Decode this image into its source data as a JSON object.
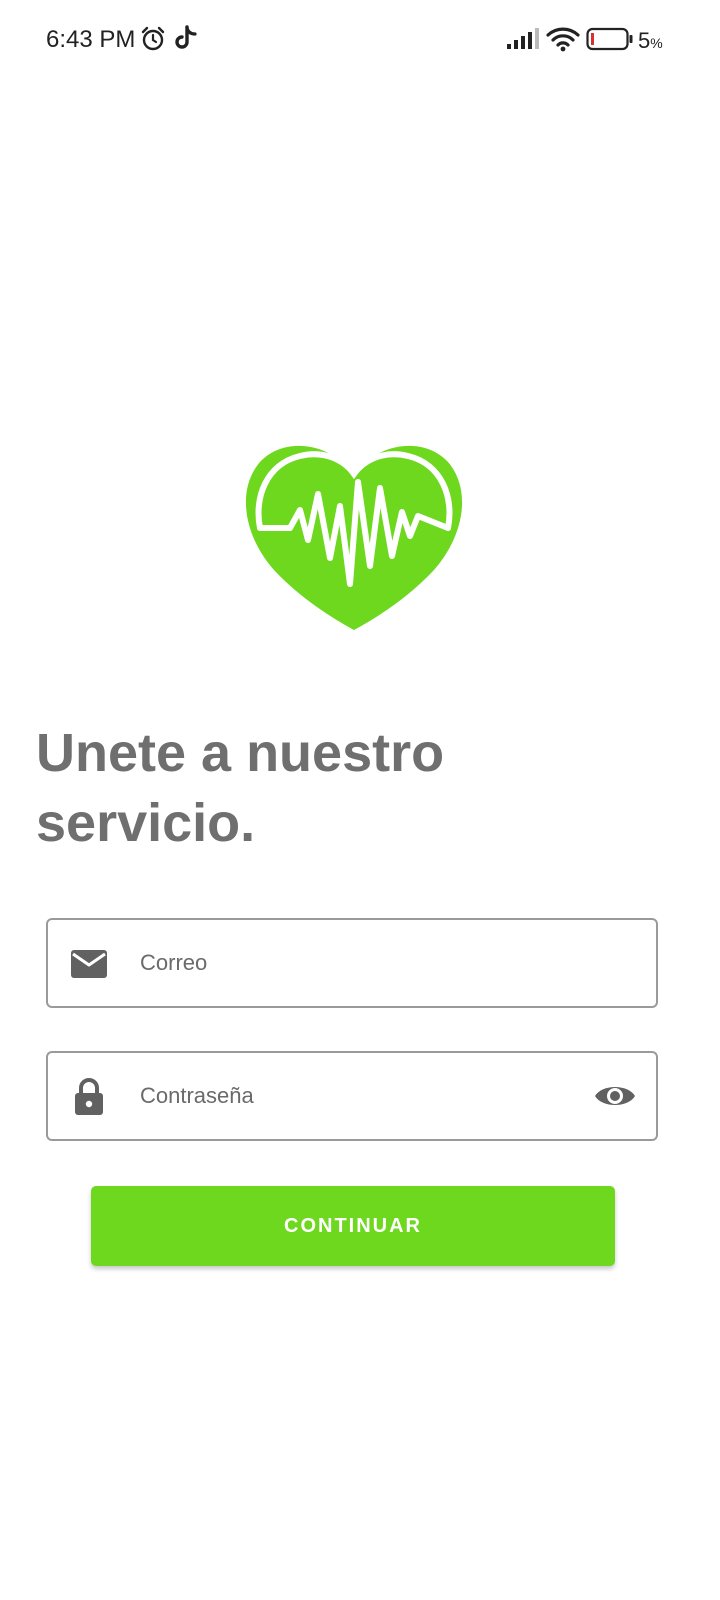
{
  "status_bar": {
    "time": "6:43 PM",
    "battery_percent": "5",
    "battery_unit": "%",
    "icons": [
      "alarm-icon",
      "tiktok-icon",
      "signal-icon",
      "wifi-icon",
      "battery-icon"
    ]
  },
  "logo": {
    "icon": "heart-pulse-icon",
    "color": "#6ed81f"
  },
  "headline": {
    "text": "Unete a nuestro servicio."
  },
  "form": {
    "email": {
      "icon": "mail-icon",
      "placeholder": "Correo",
      "value": ""
    },
    "password": {
      "icon": "lock-icon",
      "placeholder": "Contraseña",
      "value": "",
      "toggle_icon": "eye-icon"
    },
    "continue_label": "CONTINUAR"
  },
  "colors": {
    "accent": "#6ed81f",
    "headline": "#6f6f6f",
    "icon": "#616161",
    "border": "#9a9a9a"
  }
}
